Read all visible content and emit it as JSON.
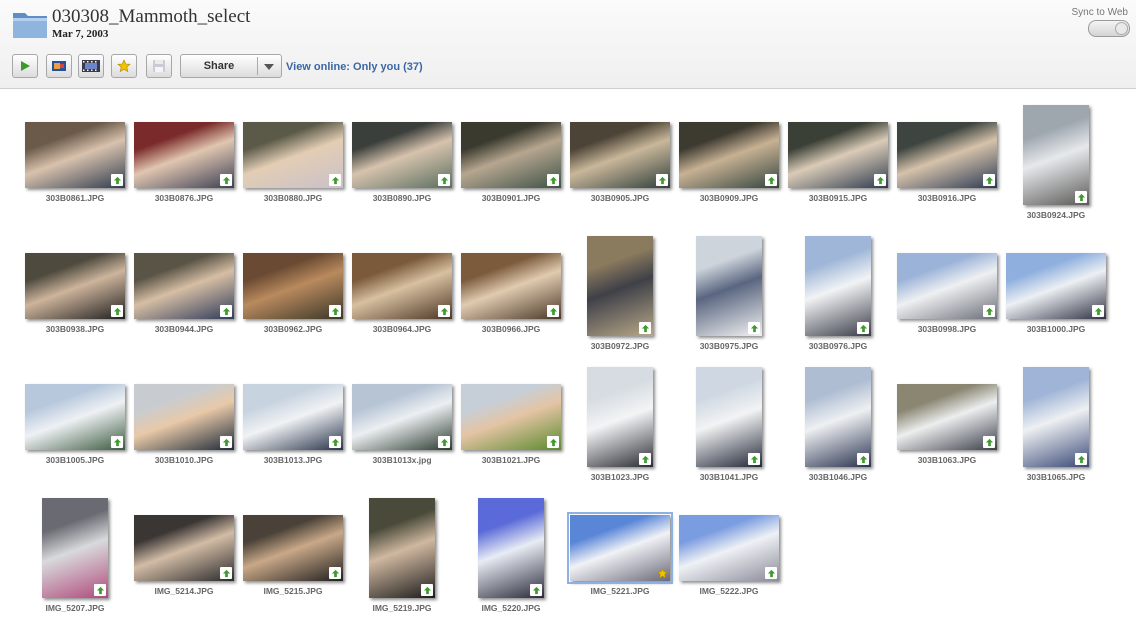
{
  "header": {
    "album_title": "030308_Mammoth_select",
    "album_date": "Mar 7, 2003",
    "sync_label": "Sync to Web",
    "share_label": "Share",
    "view_online": "View online: Only you (37)"
  },
  "toolbar_icons": [
    "play-icon",
    "slideshow-icon",
    "film-icon",
    "star-icon",
    "save-icon"
  ],
  "colors": {
    "link": "#3b66a6",
    "upload_arrow": "#3f9a2e",
    "star": "#f2c200",
    "selection": "#8eb1e3"
  },
  "photos": [
    {
      "name": "303B0861.JPG",
      "orientation": "landscape",
      "badge": "upload-arrow",
      "colors": [
        "#6b5a4a",
        "#d8c2ad",
        "#2f3b4f"
      ]
    },
    {
      "name": "303B0876.JPG",
      "orientation": "landscape",
      "badge": "upload-arrow",
      "colors": [
        "#7a2a2a",
        "#e0c6b0",
        "#3b3f55"
      ]
    },
    {
      "name": "303B0880.JPG",
      "orientation": "landscape",
      "badge": "upload-arrow",
      "colors": [
        "#5b5a48",
        "#e3cdb4",
        "#c9c1c9"
      ]
    },
    {
      "name": "303B0890.JPG",
      "orientation": "landscape",
      "badge": "upload-arrow",
      "colors": [
        "#3b3f3b",
        "#d6c3ad",
        "#5a6e5f"
      ]
    },
    {
      "name": "303B0901.JPG",
      "orientation": "landscape",
      "badge": "upload-arrow",
      "colors": [
        "#3a3a2e",
        "#b6a68f",
        "#3e5248"
      ]
    },
    {
      "name": "303B0905.JPG",
      "orientation": "landscape",
      "badge": "upload-arrow",
      "colors": [
        "#4c4436",
        "#c9b79a",
        "#2f3f3b"
      ]
    },
    {
      "name": "303B0909.JPG",
      "orientation": "landscape",
      "badge": "upload-arrow",
      "colors": [
        "#3d3a30",
        "#c7b193",
        "#34453f"
      ]
    },
    {
      "name": "303B0915.JPG",
      "orientation": "landscape",
      "badge": "upload-arrow",
      "colors": [
        "#3a4036",
        "#dacbb7",
        "#2d3b4f"
      ]
    },
    {
      "name": "303B0916.JPG",
      "orientation": "landscape",
      "badge": "upload-arrow",
      "colors": [
        "#3e4540",
        "#d5c2aa",
        "#2b3a55"
      ]
    },
    {
      "name": "303B0924.JPG",
      "orientation": "portrait",
      "badge": "upload-arrow",
      "colors": [
        "#9ea6ae",
        "#e6e9ec",
        "#5c5a58"
      ]
    },
    {
      "name": "303B0938.JPG",
      "orientation": "landscape",
      "badge": "upload-arrow",
      "colors": [
        "#4e4a3e",
        "#cdb49c",
        "#1f1f1f"
      ]
    },
    {
      "name": "303B0944.JPG",
      "orientation": "landscape",
      "badge": "upload-arrow",
      "colors": [
        "#5a5446",
        "#d6bea4",
        "#2e3b5a"
      ]
    },
    {
      "name": "303B0962.JPG",
      "orientation": "landscape",
      "badge": "upload-arrow",
      "colors": [
        "#6a4a32",
        "#b98a5e",
        "#3a3628"
      ]
    },
    {
      "name": "303B0964.JPG",
      "orientation": "landscape",
      "badge": "upload-arrow",
      "colors": [
        "#7a5a3a",
        "#d8c0a0",
        "#4a3626"
      ]
    },
    {
      "name": "303B0966.JPG",
      "orientation": "landscape",
      "badge": "upload-arrow",
      "colors": [
        "#7c5b3c",
        "#e0cbb0",
        "#4a3828"
      ]
    },
    {
      "name": "303B0972.JPG",
      "orientation": "portrait",
      "badge": "upload-arrow",
      "colors": [
        "#8a7a5e",
        "#3f4048",
        "#b8a888"
      ]
    },
    {
      "name": "303B0975.JPG",
      "orientation": "portrait",
      "badge": "upload-arrow",
      "colors": [
        "#cdd4dc",
        "#5a6680",
        "#f2f2f2"
      ]
    },
    {
      "name": "303B0976.JPG",
      "orientation": "portrait",
      "badge": "upload-arrow",
      "colors": [
        "#9fb6d8",
        "#f1f3f5",
        "#3a3c48"
      ]
    },
    {
      "name": "303B0998.JPG",
      "orientation": "landscape",
      "badge": "upload-arrow",
      "colors": [
        "#9bb3d8",
        "#eef0f2",
        "#6b6e78"
      ]
    },
    {
      "name": "303B1000.JPG",
      "orientation": "landscape",
      "badge": "upload-arrow",
      "colors": [
        "#8fb0de",
        "#ecf0f3",
        "#2f3142"
      ]
    },
    {
      "name": "303B1005.JPG",
      "orientation": "landscape",
      "badge": "upload-arrow",
      "colors": [
        "#b8c8dc",
        "#eef1f4",
        "#3b5a3e"
      ]
    },
    {
      "name": "303B1010.JPG",
      "orientation": "landscape",
      "badge": "upload-arrow",
      "colors": [
        "#c8ccd0",
        "#e8c9a8",
        "#1e2a3a"
      ]
    },
    {
      "name": "303B1013.JPG",
      "orientation": "landscape",
      "badge": "upload-arrow",
      "colors": [
        "#c8d3e0",
        "#f0f2f4",
        "#27324a"
      ]
    },
    {
      "name": "303B1013x.jpg",
      "orientation": "landscape",
      "badge": "upload-arrow",
      "colors": [
        "#b6c4d4",
        "#eceff2",
        "#2a3a2e"
      ]
    },
    {
      "name": "303B1021.JPG",
      "orientation": "landscape",
      "badge": "upload-arrow",
      "colors": [
        "#c6cfd8",
        "#e4c4a4",
        "#5a8a2e"
      ]
    },
    {
      "name": "303B1023.JPG",
      "orientation": "portrait",
      "badge": "upload-arrow",
      "colors": [
        "#d6dce2",
        "#f3f4f5",
        "#2a2c34"
      ]
    },
    {
      "name": "303B1041.JPG",
      "orientation": "portrait",
      "badge": "upload-arrow",
      "colors": [
        "#cfd8e2",
        "#f2f3f4",
        "#222838"
      ]
    },
    {
      "name": "303B1046.JPG",
      "orientation": "portrait",
      "badge": "upload-arrow",
      "colors": [
        "#aebdd2",
        "#eef0f2",
        "#2a3350"
      ]
    },
    {
      "name": "303B1063.JPG",
      "orientation": "landscape",
      "badge": "upload-arrow",
      "colors": [
        "#8a8672",
        "#eceeef",
        "#3a3e48"
      ]
    },
    {
      "name": "303B1065.JPG",
      "orientation": "portrait",
      "badge": "upload-arrow",
      "colors": [
        "#9fb4d6",
        "#eef0f2",
        "#3a4a78"
      ]
    },
    {
      "name": "IMG_5207.JPG",
      "orientation": "portrait",
      "badge": "upload-arrow",
      "colors": [
        "#6a6a72",
        "#d8dadc",
        "#b04a7a"
      ]
    },
    {
      "name": "IMG_5214.JPG",
      "orientation": "landscape",
      "badge": "upload-arrow",
      "colors": [
        "#3a3634",
        "#d2bca6",
        "#2a2a2a"
      ]
    },
    {
      "name": "IMG_5215.JPG",
      "orientation": "landscape",
      "badge": "upload-arrow",
      "colors": [
        "#4a4238",
        "#c9a888",
        "#1f1f1f"
      ]
    },
    {
      "name": "IMG_5219.JPG",
      "orientation": "portrait",
      "badge": "upload-arrow",
      "colors": [
        "#4a4a3a",
        "#d0b8a0",
        "#1c1c1c"
      ]
    },
    {
      "name": "IMG_5220.JPG",
      "orientation": "portrait",
      "badge": "upload-arrow",
      "colors": [
        "#5a6ad8",
        "#e8ecf4",
        "#2a2a3a"
      ]
    },
    {
      "name": "IMG_5221.JPG",
      "orientation": "landscape",
      "badge": "star",
      "selected": true,
      "colors": [
        "#5a86d8",
        "#f0f2f6",
        "#6a6a78"
      ]
    },
    {
      "name": "IMG_5222.JPG",
      "orientation": "landscape",
      "badge": "upload-arrow",
      "colors": [
        "#7a9ce0",
        "#eef1f5",
        "#8a8a98"
      ]
    }
  ]
}
